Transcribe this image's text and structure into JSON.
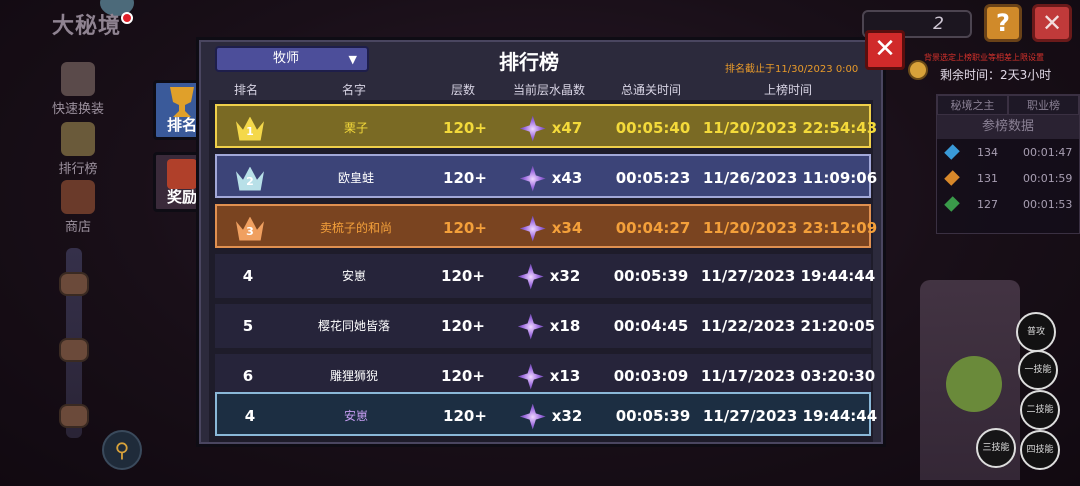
{
  "left_menu": {
    "area_title": "大秘境",
    "items": [
      {
        "label": "快速换装",
        "icon": "armor-icon"
      },
      {
        "label": "排行榜",
        "icon": "trophy-icon"
      },
      {
        "label": "商店",
        "icon": "shop-icon"
      }
    ]
  },
  "top_right": {
    "counter_value": "2",
    "help_label": "?",
    "close_label": "✕",
    "notice": "背景选定上榜职业等相差上限设置",
    "remaining_time": "剩余时间：2天3小时"
  },
  "side_panel": {
    "tabs": [
      "秘境之主",
      "职业榜"
    ],
    "title": "参榜数据",
    "rows": [
      {
        "gem_color": "#3a9ad8",
        "count": "134",
        "time": "00:01:47"
      },
      {
        "gem_color": "#d8882a",
        "count": "131",
        "time": "00:01:59"
      },
      {
        "gem_color": "#3a9a4a",
        "count": "127",
        "time": "00:01:53"
      }
    ]
  },
  "skills": [
    "普攻",
    "一技能",
    "二技能",
    "三技能",
    "四技能"
  ],
  "modal": {
    "class_select": "牧师",
    "title": "排行榜",
    "deadline": "排名截止于11/30/2023 0:00",
    "close_label": "✕",
    "tabs": [
      {
        "label": "排名",
        "active": true
      },
      {
        "label": "奖励",
        "active": false
      }
    ],
    "columns": [
      "排名",
      "名字",
      "层数",
      "当前层水晶数",
      "总通关时间",
      "上榜时间"
    ],
    "rows": [
      {
        "rank": "1",
        "tier": "gold",
        "name": "栗子",
        "floors": "120+",
        "crystals": "x47",
        "clear_time": "00:05:40",
        "listed_time": "11/20/2023 22:54:43"
      },
      {
        "rank": "2",
        "tier": "silver",
        "name": "欧皇蛙",
        "floors": "120+",
        "crystals": "x43",
        "clear_time": "00:05:23",
        "listed_time": "11/26/2023 11:09:06"
      },
      {
        "rank": "3",
        "tier": "bronze",
        "name": "卖梳子的和尚",
        "floors": "120+",
        "crystals": "x34",
        "clear_time": "00:04:27",
        "listed_time": "11/20/2023 23:12:09"
      },
      {
        "rank": "4",
        "tier": "plain",
        "name": "安崽",
        "floors": "120+",
        "crystals": "x32",
        "clear_time": "00:05:39",
        "listed_time": "11/27/2023 19:44:44"
      },
      {
        "rank": "5",
        "tier": "plain",
        "name": "樱花同她皆落",
        "floors": "120+",
        "crystals": "x18",
        "clear_time": "00:04:45",
        "listed_time": "11/22/2023 21:20:05"
      },
      {
        "rank": "6",
        "tier": "plain",
        "name": "雕狸狮猊",
        "floors": "120+",
        "crystals": "x13",
        "clear_time": "00:03:09",
        "listed_time": "11/17/2023 03:20:30"
      }
    ],
    "self_row": {
      "rank": "4",
      "tier": "self",
      "name": "安崽",
      "floors": "120+",
      "crystals": "x32",
      "clear_time": "00:05:39",
      "listed_time": "11/27/2023 19:44:44"
    },
    "crown_colors": {
      "gold": "#f4d84a",
      "silver": "#b8e0e8",
      "bronze": "#f0a060"
    }
  }
}
